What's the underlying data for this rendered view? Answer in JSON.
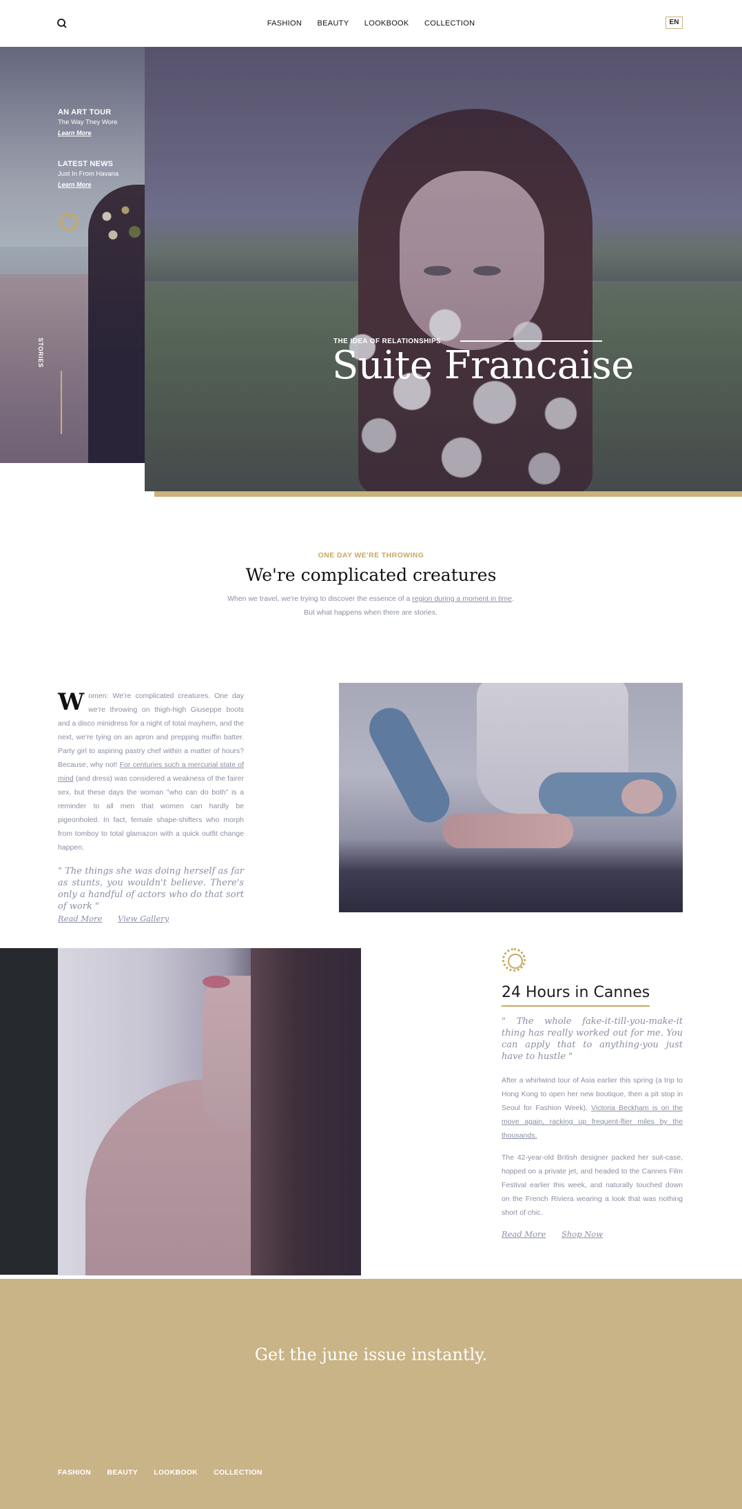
{
  "header": {
    "nav": [
      "FASHION",
      "BEAUTY",
      "LOOKBOOK",
      "COLLECTION"
    ],
    "language": "EN",
    "search_icon": "search-icon"
  },
  "hero": {
    "stories": [
      {
        "title": "AN ART TOUR",
        "subtitle": "The Way They Wore",
        "link": "Learn More"
      },
      {
        "title": "LATEST NEWS",
        "subtitle": "Just In From Havana",
        "link": "Learn More"
      }
    ],
    "vertical_label": "STORIES",
    "kicker": "THE IDEA OF RELATIONSHIPS",
    "title": "Suite Francaise",
    "accent_color": "#c9b27b"
  },
  "intro": {
    "kicker": "ONE DAY WE'RE THROWING",
    "title": "We're complicated creatures",
    "text_before": "When we travel, we're trying to discover the essence of a ",
    "text_link": "region during a moment in time",
    "text_after": ". But what happens when there are stories."
  },
  "article1": {
    "dropcap": "W",
    "text_before": "omen: We're complicated creatures. One day we're throwing on thigh-high Giuseppe boots and a disco minidress for a night of total mayhem, and the next, we're tying on an apron and prepping muffin batter. Party girl to aspiring pastry chef within a matter of hours? Because, why not! ",
    "text_link": "For centuries such a mercurial state of mind",
    "text_after": " (and dress) was considered a weakness of the fairer sex, but these days the woman \"who can do both\" is a reminder to all men that women can hardly be pigeonholed. In fact, female shape-shifters who morph from tomboy to total glamazon with a quick outfit change happen.",
    "quote": "\" The things she was doing herself as far as stunts, you wouldn't believe. There's only a handful of actors who do that sort of work \"",
    "links": [
      "Read More",
      "View Gallery"
    ]
  },
  "article2": {
    "icon": "sun-ring-icon",
    "title": "24 Hours in Cannes",
    "quote": "\" The whole fake-it-till-you-make-it thing has really worked out for me. You can apply that to anything-you just have to hustle \"",
    "p1_before": "After a whirlwind tour of Asia earlier this spring (a trip to Hong Kong to open her new boutique, then a pit stop in Seoul for Fashion Week), ",
    "p1_link": "Victoria Beckham is on the move again, racking up frequent-flier miles by the thousands.",
    "p2": "The 42-year-old British designer packed her suit-case, hopped on a private jet, and headed to the Cannes Film Festival earlier this week, and naturally touched down on the French Riviera wearing a look that was nothing short of chic.",
    "links": [
      "Read More",
      "Shop Now"
    ]
  },
  "footer": {
    "title": "Get the june issue instantly.",
    "nav": [
      "FASHION",
      "BEAUTY",
      "LOOKBOOK",
      "COLLECTION"
    ],
    "background": "#c9b487"
  }
}
